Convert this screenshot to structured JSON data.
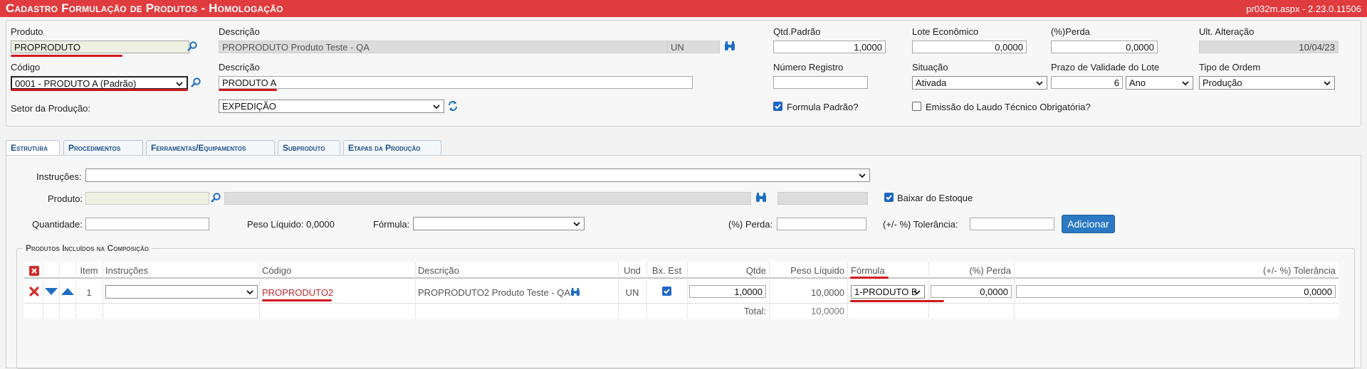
{
  "title": "Cadastro Formulação de Produtos  - Homologação",
  "version": "pr032m.aspx - 2.23.0.11506",
  "form": {
    "produto_label": "Produto",
    "produto_value": "PROPRODUTO",
    "descricao_label": "Descrição",
    "descricao_value": "PROPRODUTO Produto Teste - QA",
    "unidade": "UN",
    "qtd_padrao_label": "Qtd.Padrão",
    "qtd_padrao_value": "1,0000",
    "lote_label": "Lote Econômico",
    "lote_value": "0,0000",
    "perda_label": "(%)Perda",
    "perda_value": "0,0000",
    "ult_alt_label": "Ult. Alteração",
    "ult_alt_value": "10/04/23",
    "codigo_label": "Código",
    "codigo_value": "0001 - PRODUTO A (Padrão)",
    "descricao2_label": "Descrição",
    "descricao2_value": "PRODUTO A",
    "num_registro_label": "Número Registro",
    "num_registro_value": "",
    "situacao_label": "Situação",
    "situacao_value": "Ativada",
    "prazo_label": "Prazo de Validade do Lote",
    "prazo_value": "6",
    "prazo_unit": "Ano",
    "tipo_ordem_label": "Tipo de Ordem",
    "tipo_ordem_value": "Produção",
    "setor_label": "Setor da Produção:",
    "setor_value": "EXPEDIÇÃO",
    "formula_padrao_label": "Formula Padrão?",
    "formula_padrao_checked": true,
    "laudo_label": "Emissão do Laudo Técnico Obrigatória?",
    "laudo_checked": false
  },
  "tabs": [
    {
      "label": "Estrutura",
      "active": true
    },
    {
      "label": "Procedimentos",
      "active": false
    },
    {
      "label": "Ferramentas/Equipamentos",
      "active": false
    },
    {
      "label": "Subproduto",
      "active": false
    },
    {
      "label": "Etapas da Produção",
      "active": false
    }
  ],
  "estrutura": {
    "instrucoes_label": "Instruções:",
    "produto_label": "Produto:",
    "baixar_label": "Baixar do Estoque",
    "baixar_checked": true,
    "quantidade_label": "Quantidade:",
    "peso_liquido_text": "Peso Líquido: 0,0000",
    "formula_label": "Fórmula:",
    "perda_label": "(%) Perda:",
    "tolerancia_label": "(+/- %) Tolerância:",
    "adicionar_label": "Adicionar",
    "fieldset_legend": "Produtos Incluídos na Composição"
  },
  "grid": {
    "columns": [
      "Item",
      "Instruções",
      "Código",
      "Descrição",
      "Und",
      "Bx. Est",
      "Qtde",
      "Peso Líquido",
      "Fórmula",
      "(%) Perda",
      "(+/- %) Tolerância"
    ],
    "rows": [
      {
        "item": "1",
        "instrucoes": "",
        "codigo": "PROPRODUTO2",
        "descricao": "PROPRODUTO2 Produto Teste - QA",
        "und": "UN",
        "bx_est": true,
        "qtde": "1,0000",
        "peso_liquido": "10,0000",
        "formula": "1-PRODUTO B",
        "perda": "0,0000",
        "tolerancia": "0,0000"
      }
    ],
    "total_label": "Total:",
    "total_value": "10,0000"
  },
  "colors": {
    "title_bar": "#e03b3f",
    "accent_red": "#d0181e",
    "link_blue": "#1c4f8a",
    "button_blue": "#2a79c2"
  }
}
